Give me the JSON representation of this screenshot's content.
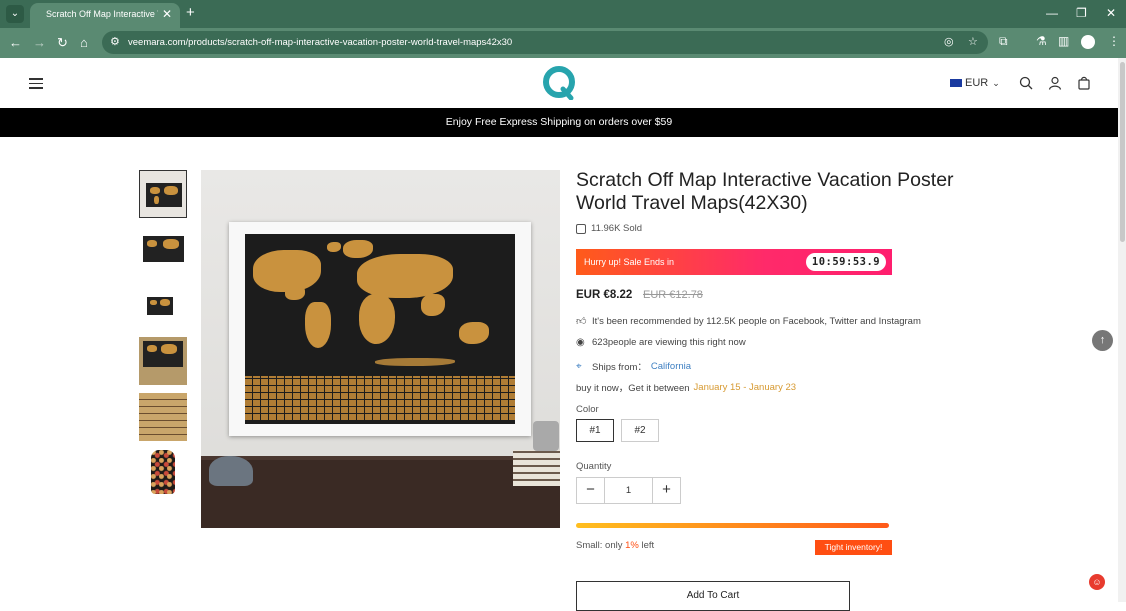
{
  "browser": {
    "tab_title": "Scratch Off Map Interactive Vac",
    "url": "veemara.com/products/scratch-off-map-interactive-vacation-poster-world-travel-maps42x30"
  },
  "header": {
    "currency": "EUR"
  },
  "banner": {
    "text": "Enjoy Free Express Shipping on orders over $59"
  },
  "product": {
    "title": "Scratch Off Map Interactive Vacation Poster World Travel Maps(42X30)",
    "sold": "11.96K Sold",
    "sale_text": "Hurry up! Sale Ends in",
    "countdown": "10:59:53.9",
    "price": "EUR €8.22",
    "old_price": "EUR €12.78",
    "recommended": "It's been recommended by 112.5K people on Facebook, Twitter and Instagram",
    "viewing": "623people are viewing this right now",
    "ships_label": "Ships from：",
    "ships_from": "California",
    "delivery_prefix": "buy it now，Get it between",
    "delivery_start": "January 15",
    "delivery_sep": " - ",
    "delivery_end": "January 23",
    "color_label": "Color",
    "colors": [
      "#1",
      "#2"
    ],
    "quantity_label": "Quantity",
    "quantity": "1",
    "inventory_prefix": "Small: only",
    "inventory_percent": "1%",
    "inventory_suffix": "left",
    "inventory_level": 0.99,
    "tight_label": "Tight inventory!",
    "add_to_cart": "Add To Cart"
  },
  "colors": {
    "accent_blue": "#3f80c2",
    "accent_orange": "#d79a32",
    "sale_red": "#ff4e12",
    "browser_green": "#5a8a72"
  }
}
